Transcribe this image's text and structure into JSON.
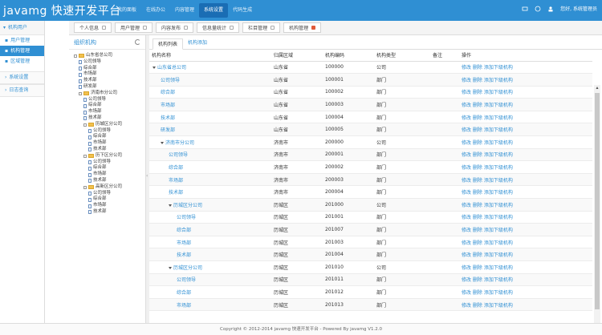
{
  "app": {
    "brand": "javamg 快速开发平台"
  },
  "topnav": [
    "我的面板",
    "在线办公",
    "内容管理",
    "系统设置",
    "代码生成"
  ],
  "topnav_active": 3,
  "user": {
    "label": "您好, 系统管理员"
  },
  "leftnav": {
    "section1": "机构用户",
    "items": [
      "用户管理",
      "机构管理",
      "区域管理"
    ],
    "active": 1,
    "section2": "系统设置",
    "section3": "日志查询"
  },
  "tabs": [
    "个人信息",
    "用户管理",
    "内容发布",
    "信息量统计",
    "栏目管理",
    "机构管理"
  ],
  "tabs_active": 5,
  "tree": {
    "title": "组织机构",
    "nodes": [
      {
        "label": "山东省总公司",
        "level": 0,
        "type": "folder"
      },
      {
        "label": "公司领导",
        "level": 1,
        "type": "doc"
      },
      {
        "label": "综合部",
        "level": 1,
        "type": "doc"
      },
      {
        "label": "市场部",
        "level": 1,
        "type": "doc"
      },
      {
        "label": "技术部",
        "level": 1,
        "type": "doc"
      },
      {
        "label": "研发部",
        "level": 1,
        "type": "doc"
      },
      {
        "label": "济南市分公司",
        "level": 1,
        "type": "folder"
      },
      {
        "label": "公司领导",
        "level": 2,
        "type": "doc"
      },
      {
        "label": "综合部",
        "level": 2,
        "type": "doc"
      },
      {
        "label": "市场部",
        "level": 2,
        "type": "doc"
      },
      {
        "label": "技术部",
        "level": 2,
        "type": "doc"
      },
      {
        "label": "历城区分公司",
        "level": 2,
        "type": "folder"
      },
      {
        "label": "公司领导",
        "level": 3,
        "type": "doc"
      },
      {
        "label": "综合部",
        "level": 3,
        "type": "doc"
      },
      {
        "label": "市场部",
        "level": 3,
        "type": "doc"
      },
      {
        "label": "技术部",
        "level": 3,
        "type": "doc"
      },
      {
        "label": "历下区分公司",
        "level": 2,
        "type": "folder"
      },
      {
        "label": "公司领导",
        "level": 3,
        "type": "doc"
      },
      {
        "label": "综合部",
        "level": 3,
        "type": "doc"
      },
      {
        "label": "市场部",
        "level": 3,
        "type": "doc"
      },
      {
        "label": "技术部",
        "level": 3,
        "type": "doc"
      },
      {
        "label": "高新区分公司",
        "level": 2,
        "type": "folder"
      },
      {
        "label": "公司领导",
        "level": 3,
        "type": "doc"
      },
      {
        "label": "综合部",
        "level": 3,
        "type": "doc"
      },
      {
        "label": "市场部",
        "level": 3,
        "type": "doc"
      },
      {
        "label": "技术部",
        "level": 3,
        "type": "doc"
      }
    ]
  },
  "subtabs": [
    "机构列表",
    "机构添加"
  ],
  "subtabs_active": 0,
  "table": {
    "headers": [
      "机构名称",
      "归属区域",
      "机构编码",
      "机构类型",
      "备注",
      "操作"
    ],
    "rows": [
      {
        "name": "山东省总公司",
        "indent": 0,
        "caret": true,
        "area": "山东省",
        "code": "100000",
        "type": "公司",
        "remark": "",
        "ops": "修改 删除 添加下级机构"
      },
      {
        "name": "公司领导",
        "indent": 1,
        "caret": false,
        "area": "山东省",
        "code": "100001",
        "type": "部门",
        "remark": "",
        "ops": "修改 删除 添加下级机构"
      },
      {
        "name": "综合部",
        "indent": 1,
        "caret": false,
        "area": "山东省",
        "code": "100002",
        "type": "部门",
        "remark": "",
        "ops": "修改 删除 添加下级机构"
      },
      {
        "name": "市场部",
        "indent": 1,
        "caret": false,
        "area": "山东省",
        "code": "100003",
        "type": "部门",
        "remark": "",
        "ops": "修改 删除 添加下级机构"
      },
      {
        "name": "技术部",
        "indent": 1,
        "caret": false,
        "area": "山东省",
        "code": "100004",
        "type": "部门",
        "remark": "",
        "ops": "修改 删除 添加下级机构"
      },
      {
        "name": "研发部",
        "indent": 1,
        "caret": false,
        "area": "山东省",
        "code": "100005",
        "type": "部门",
        "remark": "",
        "ops": "修改 删除 添加下级机构"
      },
      {
        "name": "济南市分公司",
        "indent": 1,
        "caret": true,
        "area": "济南市",
        "code": "200000",
        "type": "公司",
        "remark": "",
        "ops": "修改 删除 添加下级机构"
      },
      {
        "name": "公司领导",
        "indent": 2,
        "caret": false,
        "area": "济南市",
        "code": "200001",
        "type": "部门",
        "remark": "",
        "ops": "修改 删除 添加下级机构"
      },
      {
        "name": "综合部",
        "indent": 2,
        "caret": false,
        "area": "济南市",
        "code": "200002",
        "type": "部门",
        "remark": "",
        "ops": "修改 删除 添加下级机构"
      },
      {
        "name": "市场部",
        "indent": 2,
        "caret": false,
        "area": "济南市",
        "code": "200003",
        "type": "部门",
        "remark": "",
        "ops": "修改 删除 添加下级机构"
      },
      {
        "name": "技术部",
        "indent": 2,
        "caret": false,
        "area": "济南市",
        "code": "200004",
        "type": "部门",
        "remark": "",
        "ops": "修改 删除 添加下级机构"
      },
      {
        "name": "历城区分公司",
        "indent": 2,
        "caret": true,
        "area": "历城区",
        "code": "201000",
        "type": "公司",
        "remark": "",
        "ops": "修改 删除 添加下级机构"
      },
      {
        "name": "公司领导",
        "indent": 3,
        "caret": false,
        "area": "历城区",
        "code": "201001",
        "type": "部门",
        "remark": "",
        "ops": "修改 删除 添加下级机构"
      },
      {
        "name": "综合部",
        "indent": 3,
        "caret": false,
        "area": "历城区",
        "code": "201007",
        "type": "部门",
        "remark": "",
        "ops": "修改 删除 添加下级机构"
      },
      {
        "name": "市场部",
        "indent": 3,
        "caret": false,
        "area": "历城区",
        "code": "201003",
        "type": "部门",
        "remark": "",
        "ops": "修改 删除 添加下级机构"
      },
      {
        "name": "技术部",
        "indent": 3,
        "caret": false,
        "area": "历城区",
        "code": "201004",
        "type": "部门",
        "remark": "",
        "ops": "修改 删除 添加下级机构"
      },
      {
        "name": "历城区分公司",
        "indent": 2,
        "caret": true,
        "area": "历城区",
        "code": "201010",
        "type": "公司",
        "remark": "",
        "ops": "修改 删除 添加下级机构"
      },
      {
        "name": "公司领导",
        "indent": 3,
        "caret": false,
        "area": "历城区",
        "code": "201011",
        "type": "部门",
        "remark": "",
        "ops": "修改 删除 添加下级机构"
      },
      {
        "name": "综合部",
        "indent": 3,
        "caret": false,
        "area": "历城区",
        "code": "201012",
        "type": "部门",
        "remark": "",
        "ops": "修改 删除 添加下级机构"
      },
      {
        "name": "市场部",
        "indent": 3,
        "caret": false,
        "area": "历城区",
        "code": "201013",
        "type": "部门",
        "remark": "",
        "ops": "修改 删除 添加下级机构"
      }
    ]
  },
  "footer": "Copyright © 2012-2014 javamg 快速开发平台 - Powered By javamg V1.2.0",
  "colors": {
    "brand": "#2f8fd3",
    "tab_close_active": "#e05a3a"
  }
}
